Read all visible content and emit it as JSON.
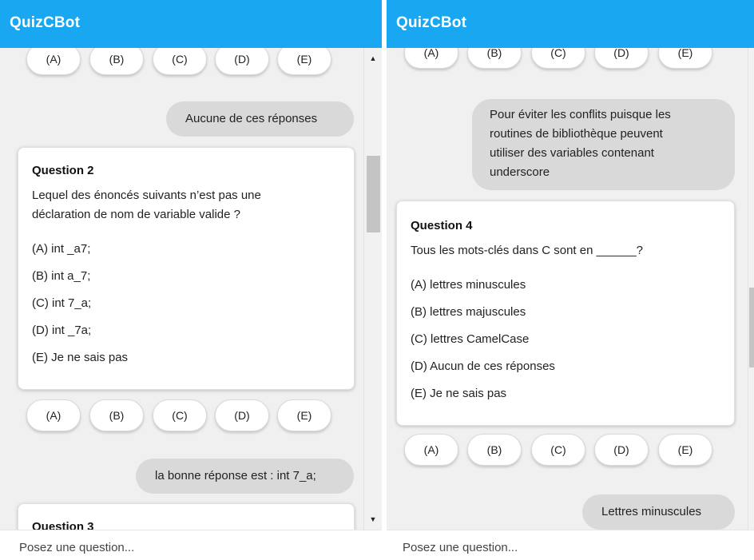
{
  "left": {
    "header_title": "QuizCBot",
    "options_labels": [
      "(A)",
      "(B)",
      "(C)",
      "(D)",
      "(E)"
    ],
    "user_reply_1": "Aucune de ces réponses",
    "question2": {
      "title": "Question 2",
      "text_line1": "Lequel des énoncés suivants n’est pas une",
      "text_line2": "déclaration de nom de variable valide ?",
      "choices": [
        "(A) int _a7;",
        "(B) int a_7;",
        "(C) int 7_a;",
        "(D) int _7a;",
        "(E) Je ne sais pas"
      ]
    },
    "bot_reply": "la bonne réponse est : int 7_a;",
    "question3_title": "Question 3",
    "input_placeholder": "Posez une question..."
  },
  "right": {
    "header_title": "QuizCBot",
    "options_labels": [
      "(A)",
      "(B)",
      "(C)",
      "(D)",
      "(E)"
    ],
    "user_reply_lines": [
      "Pour éviter les conflits puisque les",
      "routines de bibliothèque peuvent",
      "utiliser des variables contenant",
      "underscore"
    ],
    "question4": {
      "title": "Question 4",
      "text": "Tous les mots-clés dans C sont en ______?",
      "choices": [
        "(A) lettres minuscules",
        "(B) lettres majuscules",
        "(C) lettres CamelCase",
        "(D) Aucun de ces réponses",
        "(E) Je ne sais pas"
      ]
    },
    "user_reply_2": "Lettres minuscules",
    "input_placeholder": "Posez une question..."
  },
  "icons": {
    "scroll_up": "scroll-up-arrow-icon",
    "scroll_down": "scroll-down-arrow-icon"
  },
  "colors": {
    "header": "#18a7f0",
    "chat_background": "#f0f0f0",
    "user_bubble": "#d9d9d9",
    "card": "#ffffff"
  }
}
